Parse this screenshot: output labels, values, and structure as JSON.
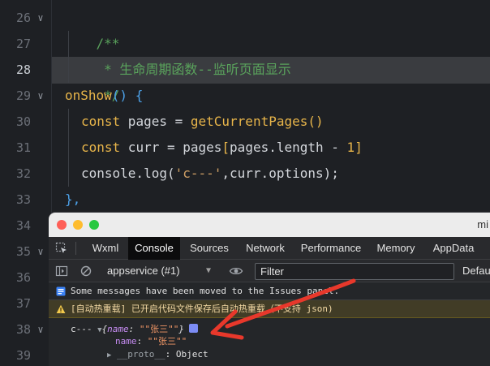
{
  "editor": {
    "line_numbers": [
      "26",
      "27",
      "28",
      "29",
      "30",
      "31",
      "32",
      "33",
      "34",
      "35",
      "36",
      "37",
      "38",
      "39"
    ],
    "active_line": "28",
    "code": {
      "l26": "/**",
      "l27": " * 生命周期函数--监听页面显示",
      "l28": " */",
      "l29_fn": "onShow",
      "l29_rest": "() {",
      "l30_kw": "const",
      "l30_var": " pages = ",
      "l30_fn": "getCurrentPages",
      "l30_rest": "()",
      "l31_kw": "const",
      "l31_var": " curr = pages",
      "l31_open": "[",
      "l31_mid": "pages.length - ",
      "l31_num": "1",
      "l31_close": "]",
      "l32_a": "console.log(",
      "l32_str": "'c---'",
      "l32_b": ",curr.options);",
      "l33": "},"
    }
  },
  "devtools": {
    "window_title": "mi",
    "tabs": [
      "Wxml",
      "Console",
      "Sources",
      "Network",
      "Performance",
      "Memory",
      "AppData"
    ],
    "active_tab": "Console",
    "toolbar": {
      "context": "appservice (#1)",
      "filter_placeholder": "Filter",
      "levels_label": "Default"
    },
    "messages": {
      "info": "Some messages have been moved to the Issues panel.",
      "warn": "[自动热重载] 已开启代码文件保存后自动热重载（不支持 json)"
    },
    "log": {
      "label": "c---",
      "summary_open": "{",
      "summary_key": "name",
      "summary_sep": ": ",
      "summary_val": "\"\"张三\"\"",
      "summary_close": "}",
      "prop_key": "name",
      "prop_sep": ": ",
      "prop_val": "\"\"张三\"\"",
      "proto_key": "__proto__",
      "proto_val": ": Object"
    }
  },
  "colors": {
    "arrow": "#e8382b",
    "comment": "#5aa35c",
    "keyword": "#e8b54a",
    "brace": "#4da2ea"
  }
}
